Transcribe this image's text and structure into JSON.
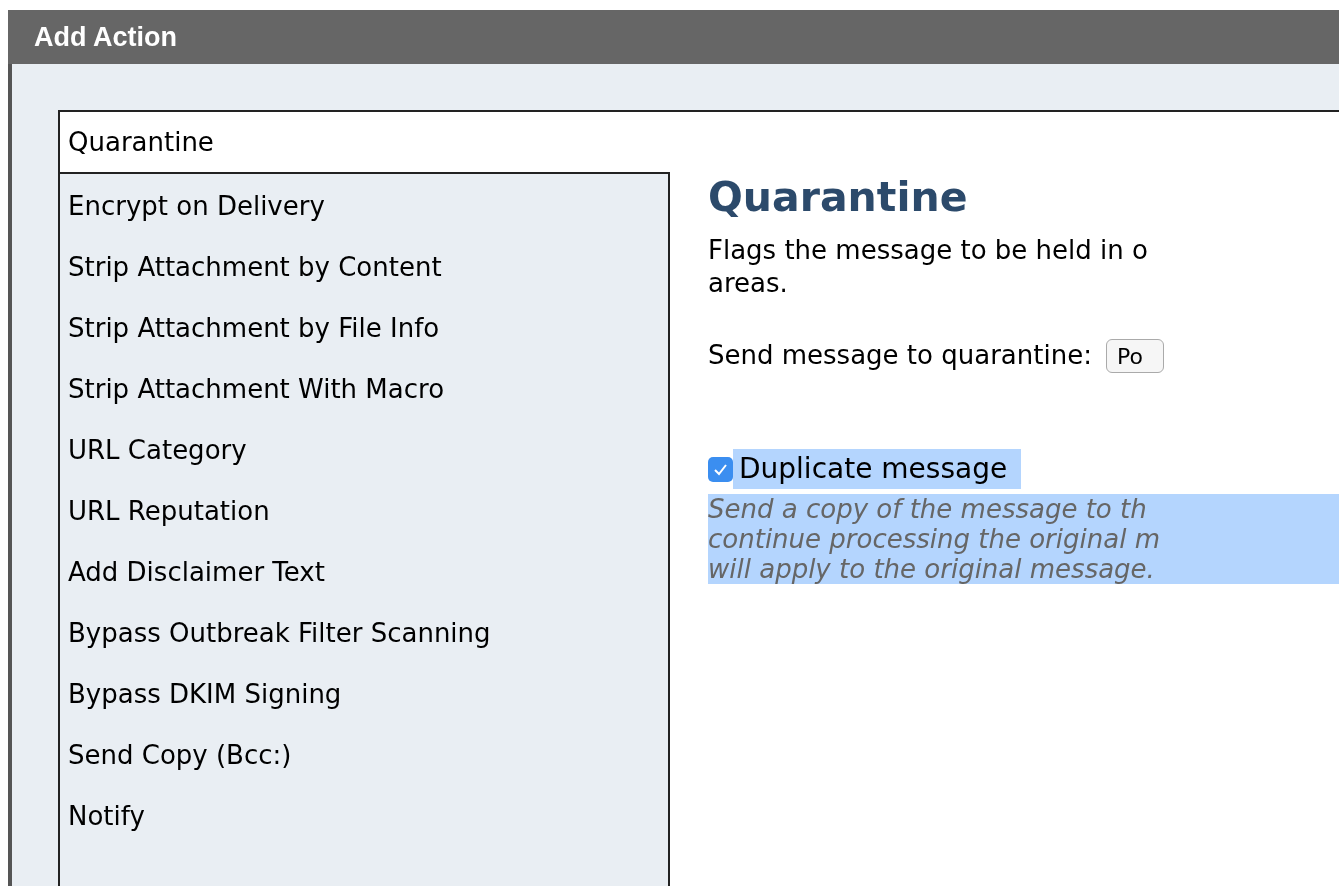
{
  "window": {
    "title": "Add Action"
  },
  "action_field": {
    "value": "Quarantine"
  },
  "action_list": [
    {
      "label": "Encrypt on Delivery",
      "selected": false
    },
    {
      "label": "Strip Attachment by Content",
      "selected": false
    },
    {
      "label": "Strip Attachment by File Info",
      "selected": false
    },
    {
      "label": "Strip Attachment With Macro",
      "selected": false
    },
    {
      "label": "URL Category",
      "selected": false
    },
    {
      "label": "URL Reputation",
      "selected": false
    },
    {
      "label": "Add Disclaimer Text",
      "selected": false
    },
    {
      "label": "Bypass Outbreak Filter Scanning",
      "selected": false
    },
    {
      "label": "Bypass DKIM Signing",
      "selected": false
    },
    {
      "label": "Send Copy (Bcc:)",
      "selected": false
    },
    {
      "label": "Notify",
      "selected": false
    }
  ],
  "detail": {
    "heading": "Quarantine",
    "description_lines": [
      "Flags the message to be held in o",
      "areas."
    ],
    "quarantine_label": "Send message to quarantine:",
    "quarantine_select": "Po",
    "duplicate": {
      "label": "Duplicate message",
      "checked": true
    },
    "duplicate_help_lines": [
      "Send a copy of the message to th",
      "continue processing the original m",
      "will apply to the original message."
    ]
  }
}
